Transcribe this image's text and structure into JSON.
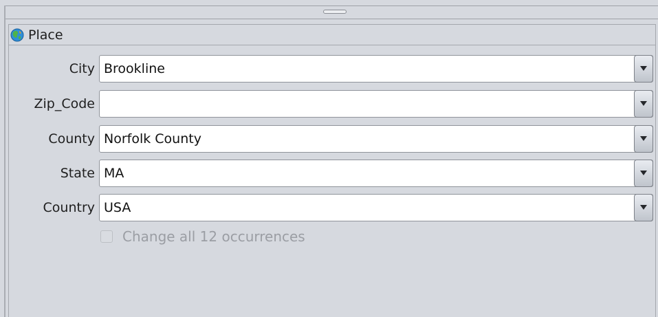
{
  "panel": {
    "title": "Place",
    "icon": "globe-icon"
  },
  "fields": [
    {
      "label": "City",
      "value": "Brookline"
    },
    {
      "label": "Zip_Code",
      "value": ""
    },
    {
      "label": "County",
      "value": "Norfolk County"
    },
    {
      "label": "State",
      "value": "MA"
    },
    {
      "label": "Country",
      "value": "USA"
    }
  ],
  "change_all": {
    "label": "Change all 12 occurrences",
    "checked": false,
    "enabled": false
  }
}
